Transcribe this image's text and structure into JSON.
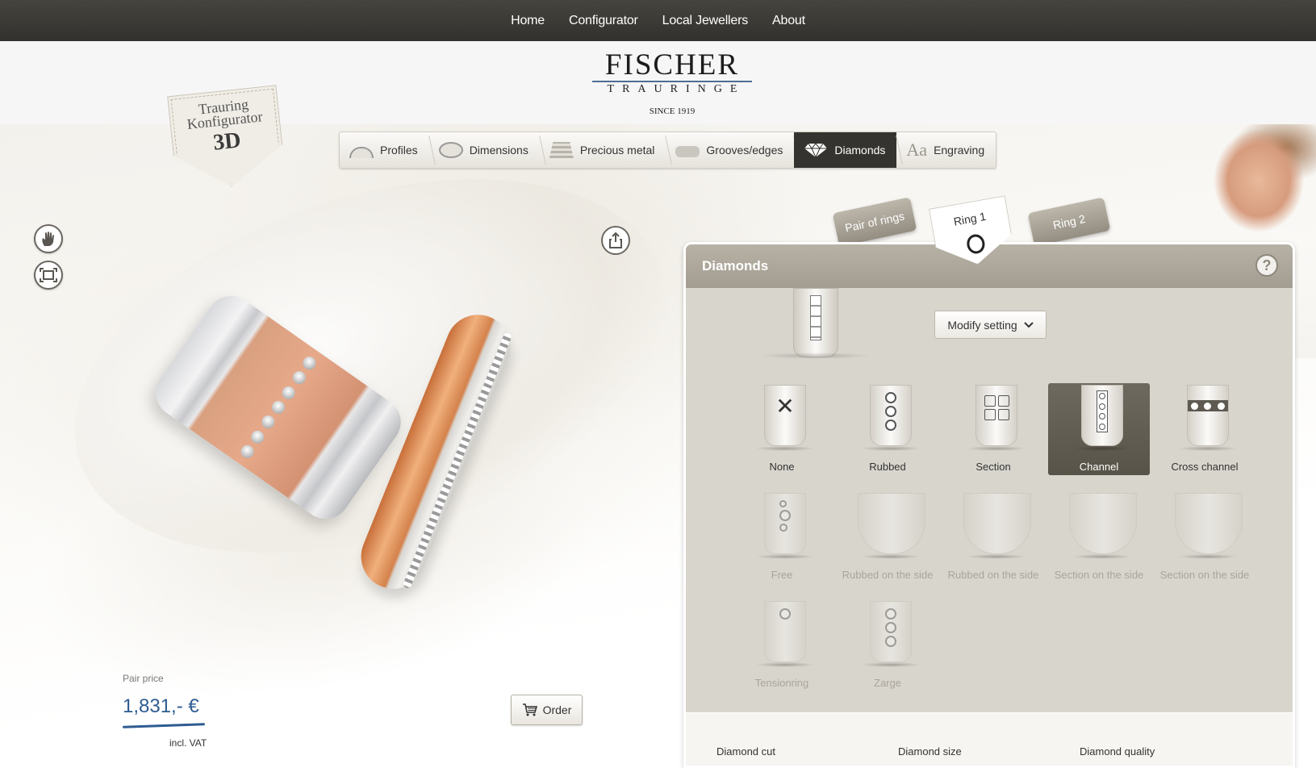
{
  "nav": {
    "items": [
      "Home",
      "Configurator",
      "Local Jewellers",
      "About"
    ]
  },
  "brand": {
    "name": "FISCHER",
    "sub": "TRAURINGE",
    "since": "SINCE 1919"
  },
  "badge": {
    "line1": "Trauring",
    "line2": "Konfigurator",
    "line3": "3D"
  },
  "tabs": [
    {
      "label": "Profiles",
      "icon": "profile-icon"
    },
    {
      "label": "Dimensions",
      "icon": "dimensions-icon"
    },
    {
      "label": "Precious metal",
      "icon": "precious-metal-icon"
    },
    {
      "label": "Grooves/edges",
      "icon": "grooves-icon"
    },
    {
      "label": "Diamonds",
      "icon": "diamond-icon",
      "active": true
    },
    {
      "label": "Engraving",
      "icon": "engraving-icon"
    }
  ],
  "tools": {
    "hand": "hand-icon",
    "fullscreen": "fullscreen-icon",
    "share": "share-icon"
  },
  "ring_selector": {
    "pair": "Pair of rings",
    "ring1": "Ring 1",
    "ring2": "Ring 2",
    "selected": "Ring 1"
  },
  "panel": {
    "title": "Diamonds",
    "help": "?",
    "modify_label": "Modify setting",
    "options": [
      {
        "label": "None",
        "state": "enabled"
      },
      {
        "label": "Rubbed",
        "state": "enabled"
      },
      {
        "label": "Section",
        "state": "enabled"
      },
      {
        "label": "Channel",
        "state": "selected"
      },
      {
        "label": "Cross channel",
        "state": "enabled"
      },
      {
        "label": "Free",
        "state": "disabled"
      },
      {
        "label": "Rubbed on the side",
        "state": "disabled"
      },
      {
        "label": "Rubbed on the side",
        "state": "disabled"
      },
      {
        "label": "Section on the side",
        "state": "disabled"
      },
      {
        "label": "Section on the side",
        "state": "disabled"
      },
      {
        "label": "Tensionring",
        "state": "disabled"
      },
      {
        "label": "Zarge",
        "state": "disabled"
      }
    ],
    "footer": {
      "cut": "Diamond cut",
      "size": "Diamond size",
      "quality": "Diamond quality"
    }
  },
  "price": {
    "label": "Pair price",
    "value": "1,831,- €",
    "vat": "incl. VAT"
  },
  "order": {
    "label": "Order"
  },
  "colors": {
    "nav_bg": "#3a3834",
    "accent": "#2e5c91",
    "panel_bg": "#d8d5cd",
    "active_tab": "#35332f"
  }
}
